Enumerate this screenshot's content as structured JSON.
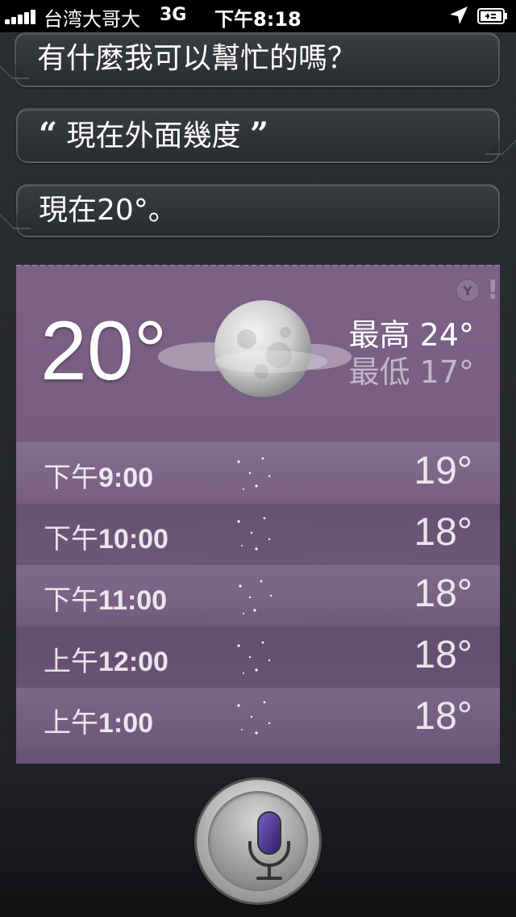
{
  "status_bar": {
    "carrier": "台湾大哥大",
    "network": "3G",
    "time": "下午8:18"
  },
  "conversation": {
    "prompt": "有什麼我可以幫忙的嗎？",
    "user_query": "現在外面幾度",
    "open_quote": "“",
    "close_quote": "”",
    "answer": "現在20°。"
  },
  "weather": {
    "current_temp": "20°",
    "high": "最高 24°",
    "low": "最低 17°",
    "provider_icon": "yahoo-logo",
    "condition_icon": "moon-with-clouds",
    "hourly": [
      {
        "time_prefix": "下午",
        "time": "9:00",
        "temp": "19°"
      },
      {
        "time_prefix": "下午",
        "time": "10:00",
        "temp": "18°"
      },
      {
        "time_prefix": "下午",
        "time": "11:00",
        "temp": "18°"
      },
      {
        "time_prefix": "上午",
        "time": "12:00",
        "temp": "18°"
      },
      {
        "time_prefix": "上午",
        "time": "1:00",
        "temp": "18°"
      }
    ]
  },
  "colors": {
    "card": "#6f5679",
    "mic_accent": "#4b2f8a"
  }
}
